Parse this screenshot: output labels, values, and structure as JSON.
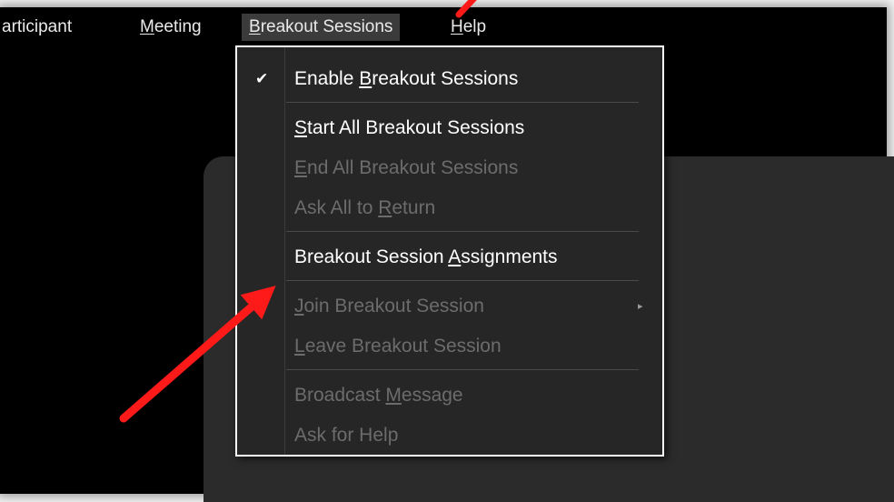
{
  "menubar": {
    "items": [
      {
        "label": "articipant",
        "underline_index": -1
      },
      {
        "label": "Meeting",
        "underline_index": 0
      },
      {
        "label": "Breakout Sessions",
        "underline_index": 0
      },
      {
        "label": "Help",
        "underline_index": 0
      }
    ],
    "active_item": "Breakout Sessions"
  },
  "dropdown": {
    "items": [
      {
        "pre": "Enable ",
        "ul": "B",
        "post": "reakout Sessions",
        "checked": true,
        "enabled": true
      },
      {
        "pre": "",
        "ul": "S",
        "post": "tart All Breakout Sessions",
        "checked": false,
        "enabled": true
      },
      {
        "pre": "",
        "ul": "E",
        "post": "nd All Breakout Sessions",
        "checked": false,
        "enabled": false
      },
      {
        "pre": "Ask All to ",
        "ul": "R",
        "post": "eturn",
        "checked": false,
        "enabled": false
      },
      {
        "pre": "Breakout Session ",
        "ul": "A",
        "post": "ssignments",
        "checked": false,
        "enabled": true
      },
      {
        "pre": "",
        "ul": "J",
        "post": "oin Breakout Session",
        "checked": false,
        "enabled": false,
        "submenu": true
      },
      {
        "pre": "",
        "ul": "L",
        "post": "eave Breakout Session",
        "checked": false,
        "enabled": false
      },
      {
        "pre": "Broadcast ",
        "ul": "M",
        "post": "essage",
        "checked": false,
        "enabled": false
      },
      {
        "pre": "Ask for Help",
        "ul": "",
        "post": "",
        "checked": false,
        "enabled": false
      }
    ],
    "check_glyph": "✔",
    "submenu_glyph": "▸"
  },
  "annotation": {
    "arrow_color": "#ff1a1a"
  }
}
